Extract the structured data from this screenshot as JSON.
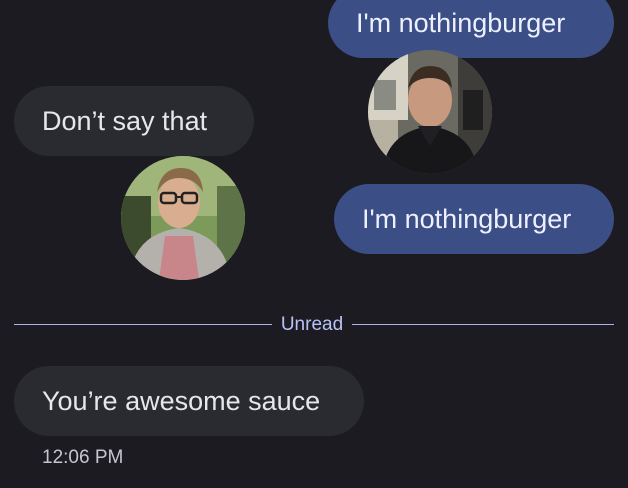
{
  "messages": [
    {
      "direction": "outgoing",
      "text": "I'm nothingburger"
    },
    {
      "direction": "incoming",
      "text": "Don’t say that"
    },
    {
      "direction": "outgoing",
      "text": "I'm nothingburger"
    },
    {
      "direction": "incoming",
      "text": "You’re awesome sauce"
    }
  ],
  "divider": {
    "label": "Unread"
  },
  "timestamp": "12:06 PM",
  "avatars": [
    {
      "icon": "person-avatar-dark-jacket-icon"
    },
    {
      "icon": "person-avatar-glasses-hoodie-icon"
    }
  ],
  "colors": {
    "background": "#1b1b21",
    "outgoing_bubble": "#3b4e86",
    "incoming_bubble": "#2a2b31",
    "divider": "#a9b3ee"
  }
}
